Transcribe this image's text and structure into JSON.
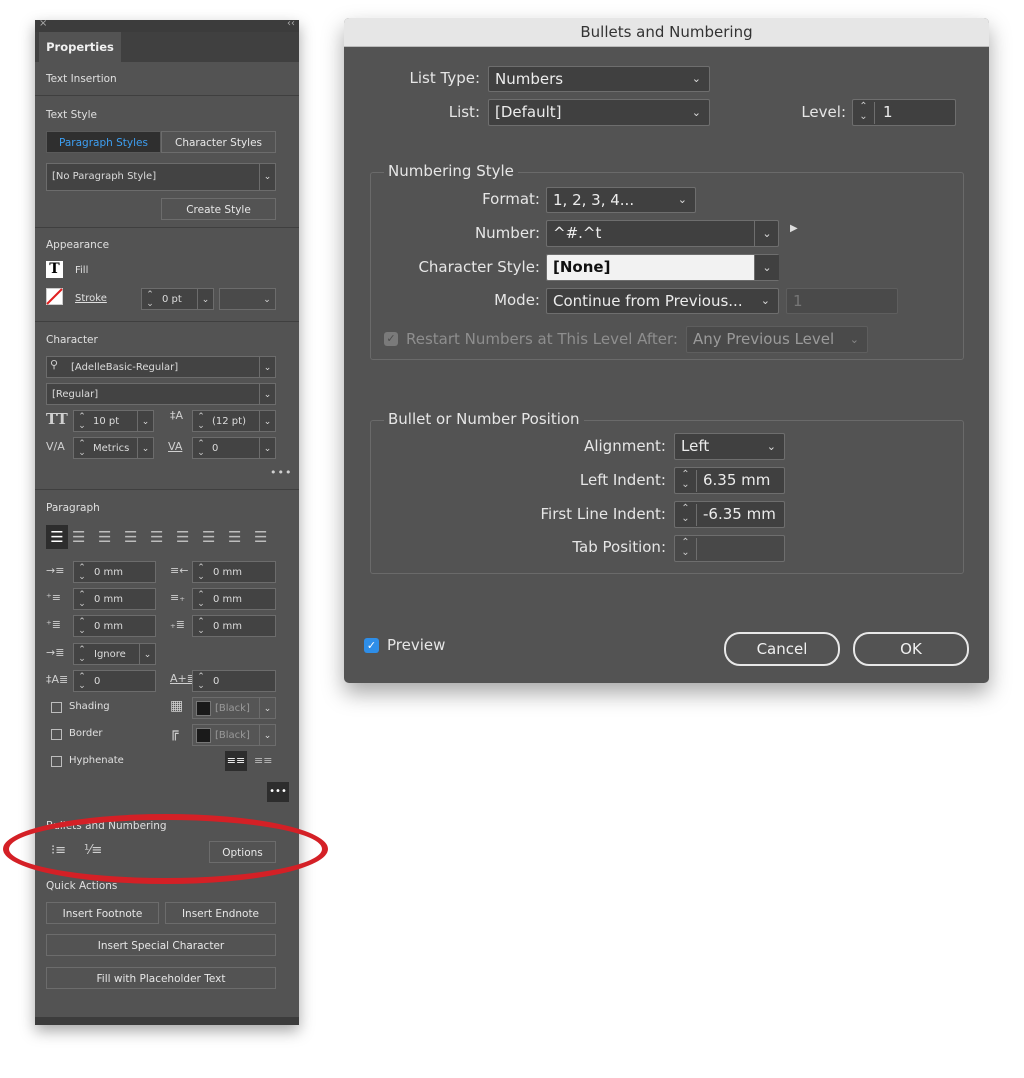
{
  "properties_panel": {
    "close_glyph": "×",
    "collapse_glyph": "‹‹",
    "tab": "Properties",
    "text_insertion": "Text Insertion",
    "text_style": {
      "heading": "Text Style",
      "tab_paragraph": "Paragraph Styles",
      "tab_character": "Character Styles",
      "style_value": "[No Paragraph Style]",
      "create_button": "Create Style"
    },
    "appearance": {
      "heading": "Appearance",
      "fill_label": "Fill",
      "stroke_label": "Stroke",
      "stroke_weight": "0 pt"
    },
    "character": {
      "heading": "Character",
      "font_family": "[AdelleBasic-Regular]",
      "font_style": "[Regular]",
      "font_size": "10 pt",
      "leading": "(12 pt)",
      "kerning": "Metrics",
      "tracking": "0"
    },
    "paragraph": {
      "heading": "Paragraph",
      "left_indent": "0 mm",
      "right_indent": "0 mm",
      "first_line_indent": "0 mm",
      "last_line_indent": "0 mm",
      "space_before": "0 mm",
      "space_after": "0 mm",
      "grid_align": "Ignore",
      "drop_cap_lines": "0",
      "drop_cap_chars": "0",
      "shading_label": "Shading",
      "shading_color": "[Black]",
      "border_label": "Border",
      "border_color": "[Black]",
      "hyphenate_label": "Hyphenate"
    },
    "bullets": {
      "heading": "Bullets and Numbering",
      "options_button": "Options"
    },
    "quick_actions": {
      "heading": "Quick Actions",
      "insert_footnote": "Insert Footnote",
      "insert_endnote": "Insert Endnote",
      "insert_special": "Insert Special Character",
      "fill_placeholder": "Fill with Placeholder Text"
    }
  },
  "dialog": {
    "title": "Bullets and Numbering",
    "list_type_label": "List Type:",
    "list_type_value": "Numbers",
    "list_label": "List:",
    "list_value": "[Default]",
    "level_label": "Level:",
    "level_value": "1",
    "numbering_style": {
      "title": "Numbering Style",
      "format_label": "Format:",
      "format_value": "1, 2, 3, 4...",
      "number_label": "Number:",
      "number_value": "^#.^t",
      "char_style_label": "Character Style:",
      "char_style_value": "[None]",
      "mode_label": "Mode:",
      "mode_value": "Continue from Previous...",
      "mode_start": "1",
      "restart_label": "Restart Numbers at This Level After:",
      "restart_value": "Any Previous Level"
    },
    "position": {
      "title": "Bullet or Number Position",
      "alignment_label": "Alignment:",
      "alignment_value": "Left",
      "left_indent_label": "Left Indent:",
      "left_indent_value": "6.35 mm",
      "first_line_label": "First Line Indent:",
      "first_line_value": "-6.35 mm",
      "tab_position_label": "Tab Position:",
      "tab_position_value": ""
    },
    "preview_label": "Preview",
    "cancel_button": "Cancel",
    "ok_button": "OK"
  },
  "colors": {
    "panel_bg": "#535353",
    "accent_blue": "#2e8ee8",
    "highlight_red": "#d42026"
  }
}
